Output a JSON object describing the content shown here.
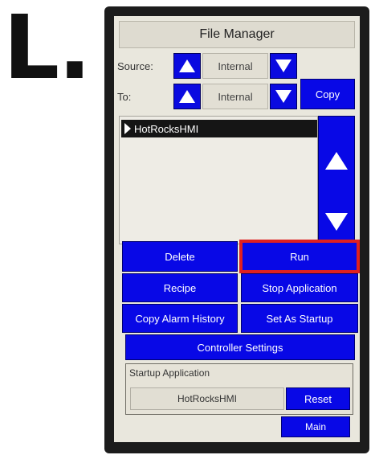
{
  "annotation": {
    "letter": "L."
  },
  "window": {
    "title": "File Manager"
  },
  "source": {
    "label": "Source:",
    "value": "Internal"
  },
  "to": {
    "label": "To:",
    "value": "Internal"
  },
  "copy_button": "Copy",
  "file_list": {
    "items": [
      "HotRocksHMI"
    ]
  },
  "buttons": {
    "delete": "Delete",
    "run": "Run",
    "recipe": "Recipe",
    "stop_application": "Stop Application",
    "copy_alarm_history": "Copy Alarm History",
    "set_as_startup": "Set As Startup",
    "controller_settings": "Controller Settings",
    "reset": "Reset",
    "main": "Main"
  },
  "startup": {
    "label": "Startup Application",
    "value": "HotRocksHMI"
  },
  "colors": {
    "button_blue": "#0808e6",
    "highlight_red": "#e02020",
    "panel": "#e9e7dd"
  }
}
